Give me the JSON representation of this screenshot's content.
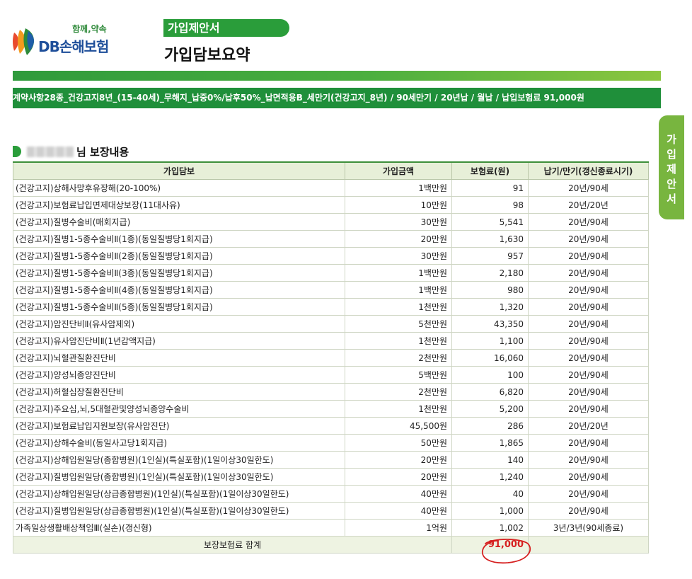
{
  "header": {
    "logo_slogan": "함께,약속",
    "logo_name": "DB손해보험",
    "doc_tag": "가입제안서",
    "doc_title": "가입담보요약"
  },
  "contract_summary": "계약사항28종_건강고지8년_(15-40세)_무해지_납중0%/납후50%_납면적용B_세만기(건강고지_8년) / 90세만기 / 20년납 / 월납 / 납입보험료 91,000원",
  "side_tab": [
    "가",
    "입",
    "제",
    "안",
    "서"
  ],
  "section": {
    "suffix": "님 보장내용"
  },
  "table": {
    "headers": [
      "가입담보",
      "가입금액",
      "보험료(원)",
      "납기/만기(갱신종료시기)"
    ],
    "rows": [
      [
        "(건강고지)상해사망후유장해(20-100%)",
        "1백만원",
        "91",
        "20년/90세"
      ],
      [
        "(건강고지)보험료납입면제대상보장(11대사유)",
        "10만원",
        "98",
        "20년/20년"
      ],
      [
        "(건강고지)질병수술비(매회지급)",
        "30만원",
        "5,541",
        "20년/90세"
      ],
      [
        "(건강고지)질병1-5종수술비Ⅱ(1종)(동일질병당1회지급)",
        "20만원",
        "1,630",
        "20년/90세"
      ],
      [
        "(건강고지)질병1-5종수술비Ⅱ(2종)(동일질병당1회지급)",
        "30만원",
        "957",
        "20년/90세"
      ],
      [
        "(건강고지)질병1-5종수술비Ⅱ(3종)(동일질병당1회지급)",
        "1백만원",
        "2,180",
        "20년/90세"
      ],
      [
        "(건강고지)질병1-5종수술비Ⅱ(4종)(동일질병당1회지급)",
        "1백만원",
        "980",
        "20년/90세"
      ],
      [
        "(건강고지)질병1-5종수술비Ⅱ(5종)(동일질병당1회지급)",
        "1천만원",
        "1,320",
        "20년/90세"
      ],
      [
        "(건강고지)암진단비Ⅱ(유사암제외)",
        "5천만원",
        "43,350",
        "20년/90세"
      ],
      [
        "(건강고지)유사암진단비Ⅱ(1년감액지급)",
        "1천만원",
        "1,100",
        "20년/90세"
      ],
      [
        "(건강고지)뇌혈관질환진단비",
        "2천만원",
        "16,060",
        "20년/90세"
      ],
      [
        "(건강고지)양성뇌종양진단비",
        "5백만원",
        "100",
        "20년/90세"
      ],
      [
        "(건강고지)허혈심장질환진단비",
        "2천만원",
        "6,820",
        "20년/90세"
      ],
      [
        "(건강고지)주요심,뇌,5대혈관및양성뇌종양수술비",
        "1천만원",
        "5,200",
        "20년/90세"
      ],
      [
        "(건강고지)보험료납입지원보장(유사암진단)",
        "45,500원",
        "286",
        "20년/20년"
      ],
      [
        "(건강고지)상해수술비(동일사고당1회지급)",
        "50만원",
        "1,865",
        "20년/90세"
      ],
      [
        "(건강고지)상해입원일당(종합병원)(1인실)(특실포함)(1일이상30일한도)",
        "20만원",
        "140",
        "20년/90세"
      ],
      [
        "(건강고지)질병입원일당(종합병원)(1인실)(특실포함)(1일이상30일한도)",
        "20만원",
        "1,240",
        "20년/90세"
      ],
      [
        "(건강고지)상해입원일당(상급종합병원)(1인실)(특실포함)(1일이상30일한도)",
        "40만원",
        "40",
        "20년/90세"
      ],
      [
        "(건강고지)질병입원일당(상급종합병원)(1인실)(특실포함)(1일이상30일한도)",
        "40만원",
        "1,000",
        "20년/90세"
      ],
      [
        "가족일상생활배상책임Ⅲ(실손)(갱신형)",
        "1억원",
        "1,002",
        "3년/3년(90세종료)"
      ]
    ],
    "total_label": "보장보험료 합계",
    "total_value": "91,000"
  },
  "colors": {
    "brand_green": "#2a9d3a",
    "band_dark": "#1f8f3a",
    "side_tab": "#78b53f",
    "highlight_red": "#d62020"
  }
}
